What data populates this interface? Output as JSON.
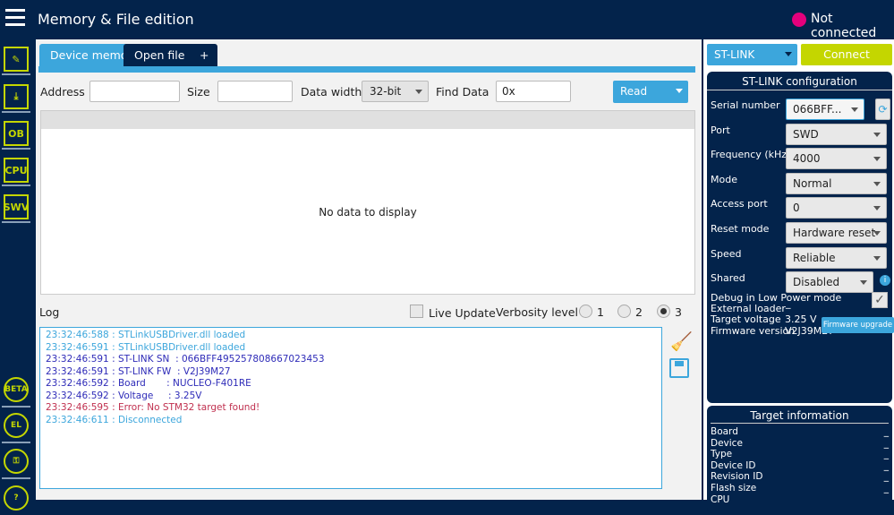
{
  "header": {
    "title": "Memory & File edition",
    "status": "Not connected",
    "status_color": "#e4007c"
  },
  "sidebar": {
    "items": [
      {
        "label": "",
        "icon": "edit-icon"
      },
      {
        "label": "",
        "icon": "download-icon"
      },
      {
        "label": "OB",
        "icon": "option-bytes-icon"
      },
      {
        "label": "CPU",
        "icon": "cpu-icon"
      },
      {
        "label": "SWV",
        "icon": "swv-icon"
      }
    ],
    "bottom": [
      {
        "label": "BETA",
        "icon": "beta-bug-icon"
      },
      {
        "label": "EL",
        "icon": "external-loader-icon"
      },
      {
        "label": "",
        "icon": "key-icon"
      },
      {
        "label": "?",
        "icon": "help-icon"
      }
    ]
  },
  "tabs": [
    {
      "label": "Device memory",
      "active": true
    },
    {
      "label": "Open file"
    },
    {
      "label": "+"
    }
  ],
  "toolbar": {
    "address_label": "Address",
    "address_value": "",
    "size_label": "Size",
    "size_value": "",
    "data_width_label": "Data width",
    "data_width_value": "32-bit",
    "find_label": "Find Data",
    "find_value": "0x",
    "read_label": "Read"
  },
  "grid": {
    "empty_text": "No data to display"
  },
  "log": {
    "title": "Log",
    "live_update": "Live Update",
    "verbosity_label": "Verbosity level",
    "levels": [
      "1",
      "2",
      "3"
    ],
    "selected_level": "3",
    "lines": [
      {
        "text": "23:32:46:588 : STLinkUSBDriver.dll loaded",
        "color": "#3ca6dc"
      },
      {
        "text": "23:32:46:591 : STLinkUSBDriver.dll loaded",
        "color": "#3ca6dc"
      },
      {
        "text": "23:32:46:591 : ST-LINK SN  : 066BFF495257808667023453",
        "color": "#2e2bb8"
      },
      {
        "text": "23:32:46:591 : ST-LINK FW  : V2J39M27",
        "color": "#2e2bb8"
      },
      {
        "text": "23:32:46:592 : Board       : NUCLEO-F401RE",
        "color": "#2e2bb8"
      },
      {
        "text": "23:32:46:592 : Voltage     : 3.25V",
        "color": "#2e2bb8"
      },
      {
        "text": "23:32:46:595 : Error: No STM32 target found!",
        "color": "#c0304f"
      },
      {
        "text": "23:32:46:611 : Disconnected",
        "color": "#3ca6dc"
      }
    ]
  },
  "probe": {
    "interface": "ST-LINK",
    "connect_label": "Connect"
  },
  "config": {
    "title": "ST-LINK configuration",
    "fields": [
      {
        "label": "Serial number",
        "value": "066BFF..."
      },
      {
        "label": "Port",
        "value": "SWD"
      },
      {
        "label": "Frequency (kHz)",
        "value": "4000"
      },
      {
        "label": "Mode",
        "value": "Normal"
      },
      {
        "label": "Access port",
        "value": "0"
      },
      {
        "label": "Reset mode",
        "value": "Hardware reset"
      },
      {
        "label": "Speed",
        "value": "Reliable"
      },
      {
        "label": "Shared",
        "value": "Disabled"
      }
    ],
    "debug_low_power": "Debug in Low Power mode",
    "external_loader_label": "External loader",
    "external_loader_value": "_",
    "target_voltage_label": "Target voltage",
    "target_voltage_value": "3.25 V",
    "firmware_version_label": "Firmware version",
    "firmware_version_value": "V2J39M27",
    "firmware_upgrade": "Firmware upgrade"
  },
  "target": {
    "title": "Target information",
    "rows": [
      {
        "label": "Board",
        "value": "_"
      },
      {
        "label": "Device",
        "value": "_"
      },
      {
        "label": "Type",
        "value": "_"
      },
      {
        "label": "Device ID",
        "value": "_"
      },
      {
        "label": "Revision ID",
        "value": "_"
      },
      {
        "label": "Flash size",
        "value": "_"
      },
      {
        "label": "CPU",
        "value": ""
      }
    ]
  }
}
